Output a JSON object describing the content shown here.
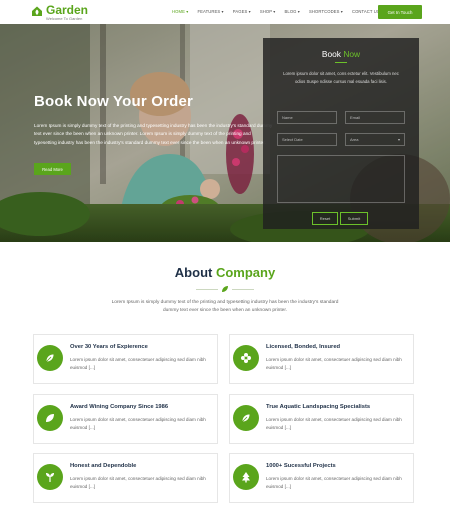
{
  "brand": {
    "name": "Garden",
    "tagline": "Welcome To Garden"
  },
  "nav": {
    "items": [
      "HOME ▾",
      "FEATURES ▾",
      "PAGES ▾",
      "SHOP ▾",
      "BLOG ▾",
      "SHORTCODES ▾",
      "CONTACT US ▾"
    ],
    "active": "HOME ▾",
    "cta": "Get In Touch"
  },
  "hero": {
    "title": "Book Now Your Order",
    "text": "Lorem Ipsum is simply dummy text of the printing and typesetting industry has been the industry's standard dummy text ever since the been when an unknown printer. Lorem Ipsum is simply dummy text of the printing and typesetting industry has been the industry's standard dummy text ever since the been when an unknown printer.",
    "button": "Read More"
  },
  "booking": {
    "title_a": "Book",
    "title_b": "Now",
    "desc": "Lorem ipsum dolor sit amet, cons ectetur elit. Vestibulum nec odios Suspe ndisse cursus mal esuada faci lisis.",
    "name_placeholder": "Name",
    "email_placeholder": "Email",
    "date_placeholder": "Select Date",
    "area_placeholder": "Area",
    "message_placeholder": "",
    "reset": "Reset",
    "submit": "Submit"
  },
  "about": {
    "title_a": "About",
    "title_b": "Company",
    "text": "Lorem Ipsum is simply dummy text of the printing and typesetting industry has been the industry's standard dummy text ever since the been when an unknown printer."
  },
  "features": [
    {
      "title": "Over 30 Years of Expierence",
      "desc": "Lorem ipsum dolor sit amet, consectetuer adipiscing sed diam nibh euismod [...]",
      "icon": "leaf-icon"
    },
    {
      "title": "Licensed, Bonded, Insured",
      "desc": "Lorem ipsum dolor sit amet, consectetuer adipiscing sed diam nibh euismod [...]",
      "icon": "flower-icon"
    },
    {
      "title": "Award Wining Company Since 1986",
      "desc": "Lorem ipsum dolor sit amet, consectetuer adipiscing sed diam nibh euismod [...]",
      "icon": "leaf-icon"
    },
    {
      "title": "True Aquatic Landspacing Specialists",
      "desc": "Lorem ipsum dolor sit amet, consectetuer adipiscing sed diam nibh euismod [...]",
      "icon": "leaf-icon"
    },
    {
      "title": "Honest and Dependoble",
      "desc": "Lorem ipsum dolor sit amet, consectetuer adipiscing sed diam nibh euismod [...]",
      "icon": "sprout-icon"
    },
    {
      "title": "1000+ Sucessful Projects",
      "desc": "Lorem ipsum dolor sit amet, consectetuer adipiscing sed diam nibh euismod [...]",
      "icon": "tree-icon"
    }
  ],
  "colors": {
    "accent": "#5aa51c",
    "heading": "#1f3047"
  }
}
